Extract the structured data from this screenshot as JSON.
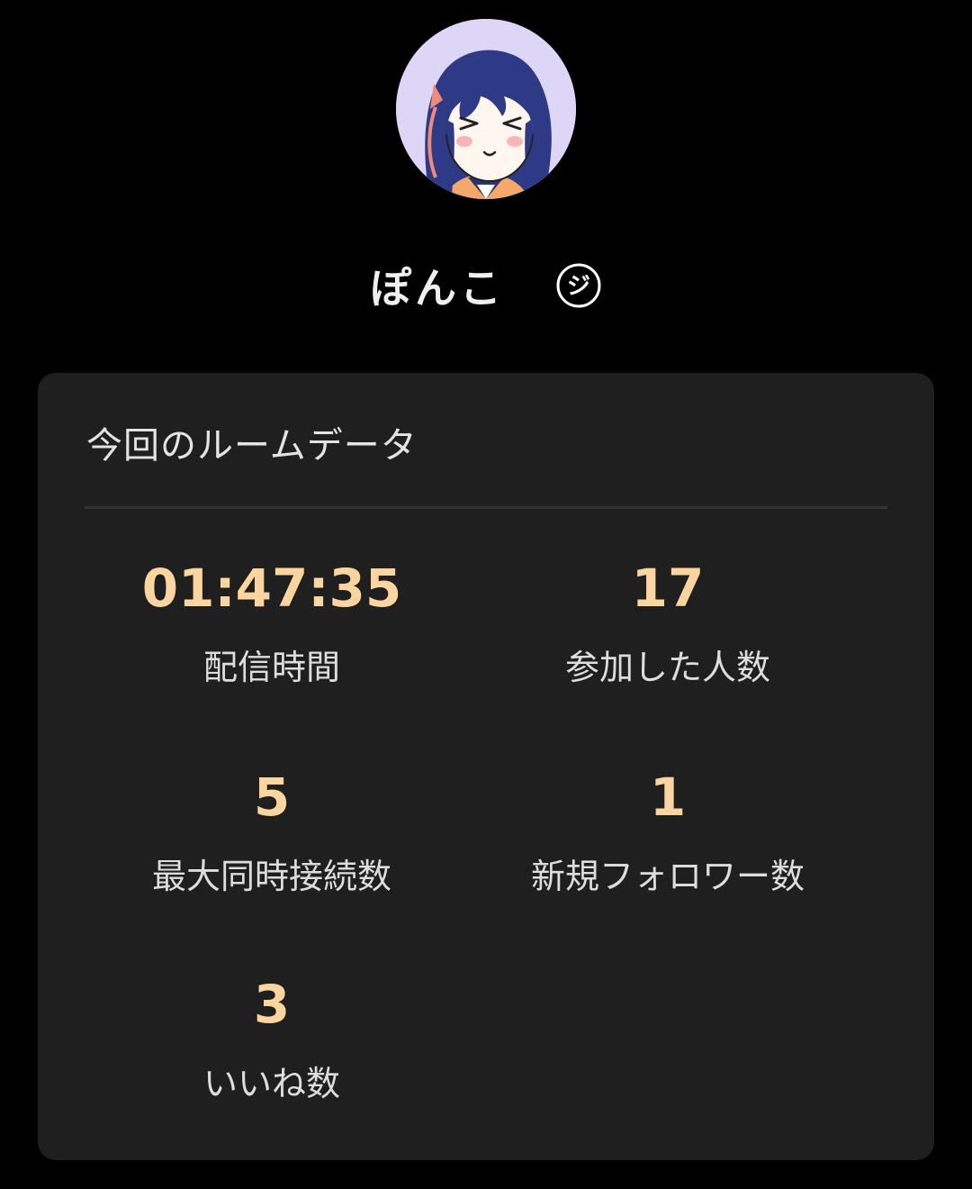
{
  "profile": {
    "username": "ぽんこ",
    "avatar_icon": "anime-girl-avatar",
    "badge_icon": "circled-ji-badge-icon",
    "badge_glyph": "ジ"
  },
  "room_data": {
    "title": "今回のルームデータ",
    "stats": [
      {
        "value": "01:47:35",
        "label": "配信時間"
      },
      {
        "value": "17",
        "label": "参加した人数"
      },
      {
        "value": "5",
        "label": "最大同時接続数"
      },
      {
        "value": "1",
        "label": "新規フォロワー数"
      },
      {
        "value": "3",
        "label": "いいね数"
      }
    ]
  },
  "colors": {
    "background": "#000000",
    "card_background": "#1f1f1f",
    "stat_value": "#fbd59f",
    "avatar_background": "#ddd6f6"
  }
}
